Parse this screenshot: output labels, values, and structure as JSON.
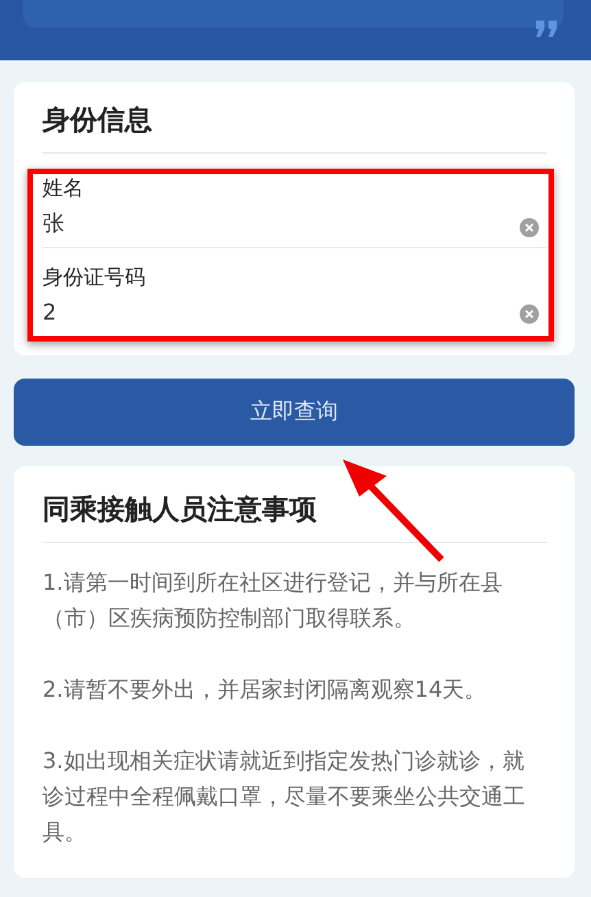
{
  "identity_card": {
    "title": "身份信息",
    "fields": [
      {
        "label": "姓名",
        "value": "张"
      },
      {
        "label": "身份证号码",
        "value": "2"
      }
    ]
  },
  "query_button": "立即查询",
  "notice_card": {
    "title": "同乘接触人员注意事项",
    "paragraphs": [
      "1.请第一时间到所在社区进行登记，并与所在县（市）区疾病预防控制部门取得联系。",
      "2.请暂不要外出，并居家封闭隔离观察14天。",
      "3.如出现相关症状请就近到指定发热门诊就诊，就诊过程中全程佩戴口罩，尽量不要乘坐公共交通工具。"
    ]
  }
}
